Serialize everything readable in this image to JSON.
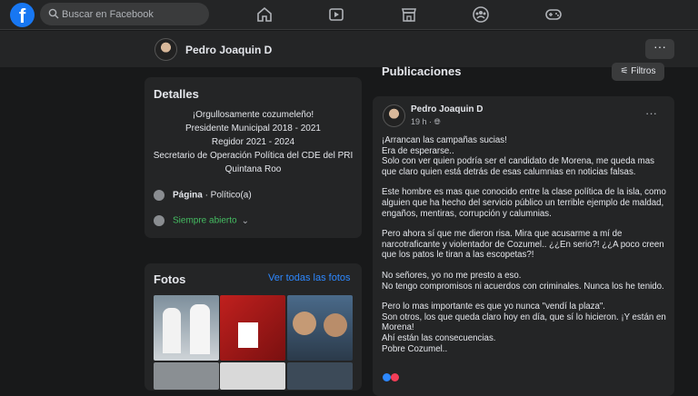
{
  "header": {
    "search_placeholder": "Buscar en Facebook",
    "brand_color": "#1877f2"
  },
  "profile": {
    "name": "Pedro Joaquin D",
    "more_label": "···"
  },
  "details": {
    "title": "Detalles",
    "bio": [
      "¡Orgullosamente cozumeleño!",
      "Presidente Municipal 2018 - 2021",
      "Regidor 2021 - 2024",
      "Secretario de Operación Política del CDE del PRI",
      "Quintana Roo"
    ],
    "page_label": "Página",
    "page_category": " · Político(a)",
    "hours": "Siempre abierto"
  },
  "photos": {
    "title": "Fotos",
    "see_all": "Ver todas las fotos"
  },
  "posts": {
    "title": "Publicaciones",
    "filter_label": "Filtros"
  },
  "post": {
    "author": "Pedro Joaquin D",
    "time": "19 h ·",
    "more": "···",
    "paragraphs": [
      "¡Arrancan las campañas sucias!\nEra de esperarse..\nSolo con ver quien podría ser el candidato de Morena, me queda mas que claro quien está detrás de esas calumnias en noticias falsas.",
      "Este hombre es mas que conocido entre la clase política de la isla, como alguien que ha hecho del servicio público un terrible ejemplo de maldad, engaños, mentiras, corrupción y calumnias.",
      "Pero ahora sí que me dieron risa. Mira que acusarme a mí de narcotraficante y violentador de Cozumel.. ¿¿En serio?! ¿¿A poco creen que los patos le tiran a las escopetas?!",
      "No señores, yo no me presto a eso.\nNo tengo compromisos ni acuerdos con criminales. Nunca los he tenido.",
      "Pero lo mas importante es que yo nunca \"vendí la plaza\".\nSon otros, los que queda claro hoy en día, que sí lo hicieron. ¡Y están en Morena!\nAhí están las consecuencias.\nPobre Cozumel.."
    ]
  }
}
